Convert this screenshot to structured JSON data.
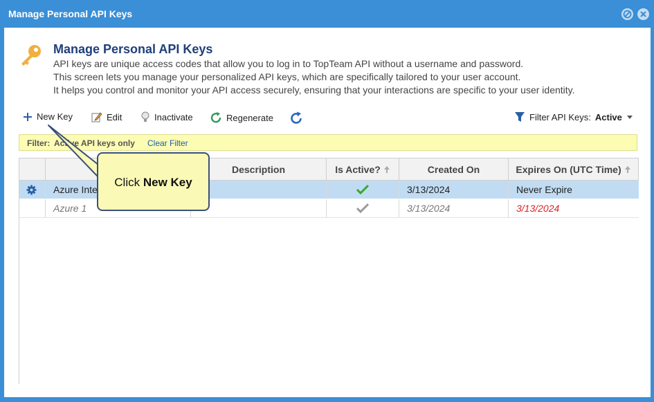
{
  "window": {
    "title": "Manage Personal API Keys"
  },
  "header": {
    "title": "Manage Personal API Keys",
    "lines": [
      "API keys are unique access codes that allow you to log in to TopTeam API without a username and password.",
      "This screen lets you manage your personalized API keys, which are specifically tailored to your user account.",
      "It helps you control and monitor your API access securely, ensuring that your interactions are specific to your user identity."
    ]
  },
  "toolbar": {
    "new_key": "New Key",
    "edit": "Edit",
    "inactivate": "Inactivate",
    "regenerate": "Regenerate",
    "filter_label": "Filter API Keys:",
    "filter_value": "Active"
  },
  "filter_bar": {
    "label": "Filter:",
    "value": "Active API keys only",
    "clear": "Clear Filter"
  },
  "table": {
    "headers": [
      "Description",
      "Is Active?",
      "Created On",
      "Expires On (UTC Time)"
    ],
    "rows": [
      {
        "name": "Azure Inte",
        "description": "",
        "created": "3/13/2024",
        "expires": "Never Expire"
      },
      {
        "name": "Azure 1",
        "description": "",
        "created": "3/13/2024",
        "expires": "3/13/2024"
      }
    ]
  },
  "callout": {
    "prefix": "Click",
    "target": "New Key"
  },
  "colors": {
    "titlebar": "#3a8fd6",
    "accent": "#1f3f7a",
    "filter_bg": "#fcfcb3",
    "selected_row": "#c1dcf2",
    "expired": "#e02020"
  }
}
